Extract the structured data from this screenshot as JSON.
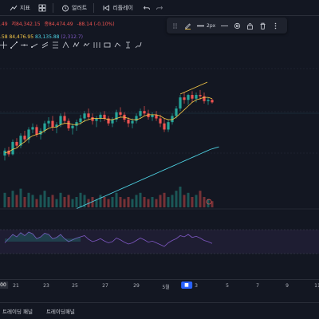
{
  "toolbar": {
    "indicators_label": "지표",
    "alert_label": "얼러트",
    "replay_label": "리플레이"
  },
  "legend": {
    "prefix": ".49",
    "high": "저84,342.15",
    "close": "종84,474.49",
    "change": "-88.14 (-0.10%)",
    "ma_values": [
      ".58",
      "84,476.95",
      "83,135.88",
      "(2,312.7)"
    ]
  },
  "float_toolbar": {
    "stroke_width_label": "2px"
  },
  "xaxis": {
    "ticks": [
      "00",
      "21",
      "23",
      "25",
      "27",
      "29",
      "5월",
      "3",
      "5",
      "7",
      "9",
      "11"
    ],
    "highlight_label": "■"
  },
  "bottom": {
    "tab1": "트레이딩 패널",
    "tab2": "트레이딩패널"
  },
  "colors": {
    "up": "#26a69a",
    "down": "#ef5350",
    "ma_short": "#f7c948",
    "ma_long": "#4dd0e1",
    "rsi": "#7e57c2",
    "accent": "#2962ff"
  },
  "chart_data": {
    "type": "candlestick",
    "candles": [
      [
        80.0,
        80.6,
        79.6,
        80.4
      ],
      [
        80.4,
        80.7,
        79.9,
        80.1
      ],
      [
        80.1,
        81.3,
        80.0,
        81.1
      ],
      [
        81.1,
        81.4,
        80.6,
        80.8
      ],
      [
        80.8,
        81.8,
        80.6,
        81.6
      ],
      [
        81.6,
        82.0,
        81.1,
        81.3
      ],
      [
        81.3,
        82.3,
        81.0,
        82.1
      ],
      [
        82.1,
        82.6,
        81.8,
        82.3
      ],
      [
        82.3,
        82.5,
        81.5,
        81.7
      ],
      [
        81.7,
        82.2,
        81.3,
        82.0
      ],
      [
        82.0,
        82.8,
        81.8,
        82.6
      ],
      [
        82.6,
        83.1,
        82.3,
        82.8
      ],
      [
        82.8,
        83.2,
        82.0,
        82.3
      ],
      [
        82.3,
        82.7,
        81.8,
        82.5
      ],
      [
        82.5,
        83.4,
        82.3,
        83.2
      ],
      [
        83.2,
        83.5,
        82.6,
        82.8
      ],
      [
        82.8,
        83.0,
        82.0,
        82.2
      ],
      [
        82.2,
        82.6,
        81.7,
        82.4
      ],
      [
        82.4,
        82.9,
        82.0,
        82.7
      ],
      [
        82.7,
        83.3,
        82.5,
        83.0
      ],
      [
        83.0,
        83.6,
        82.7,
        83.4
      ],
      [
        83.4,
        83.8,
        82.9,
        83.1
      ],
      [
        83.1,
        83.4,
        82.5,
        82.8
      ],
      [
        82.8,
        83.2,
        82.3,
        83.0
      ],
      [
        83.0,
        83.5,
        82.7,
        83.3
      ],
      [
        83.3,
        83.6,
        82.8,
        83.0
      ],
      [
        83.0,
        83.2,
        82.4,
        82.6
      ],
      [
        82.6,
        83.1,
        82.3,
        82.9
      ],
      [
        82.9,
        83.7,
        82.7,
        83.5
      ],
      [
        83.5,
        83.9,
        83.1,
        83.3
      ],
      [
        83.3,
        83.5,
        82.7,
        82.9
      ],
      [
        82.9,
        83.1,
        82.3,
        82.6
      ],
      [
        82.6,
        83.0,
        82.2,
        82.8
      ],
      [
        82.8,
        83.4,
        82.6,
        83.2
      ],
      [
        83.2,
        83.8,
        83.0,
        83.6
      ],
      [
        83.6,
        84.0,
        83.2,
        83.4
      ],
      [
        83.4,
        83.7,
        82.9,
        83.1
      ],
      [
        83.1,
        83.5,
        82.8,
        83.3
      ],
      [
        83.3,
        83.6,
        82.8,
        83.0
      ],
      [
        83.0,
        83.3,
        82.3,
        82.6
      ],
      [
        82.6,
        83.0,
        81.9,
        82.1
      ],
      [
        82.1,
        82.9,
        81.9,
        82.7
      ],
      [
        82.7,
        83.4,
        82.5,
        83.2
      ],
      [
        83.2,
        84.0,
        83.0,
        83.8
      ],
      [
        83.8,
        84.9,
        83.6,
        84.7
      ],
      [
        84.7,
        85.1,
        84.2,
        84.5
      ],
      [
        84.5,
        85.0,
        84.1,
        84.9
      ],
      [
        84.9,
        85.2,
        84.3,
        84.6
      ],
      [
        84.6,
        85.1,
        84.3,
        84.9
      ],
      [
        84.9,
        85.3,
        84.5,
        84.8
      ],
      [
        84.8,
        85.1,
        84.2,
        84.4
      ],
      [
        84.4,
        84.7,
        84.1,
        84.5
      ],
      [
        84.5,
        84.6,
        84.2,
        84.3
      ]
    ],
    "volumes": [
      7,
      5,
      8,
      6,
      9,
      5,
      7,
      6,
      4,
      6,
      8,
      5,
      6,
      4,
      7,
      5,
      6,
      4,
      5,
      7,
      6,
      4,
      5,
      4,
      6,
      5,
      4,
      5,
      7,
      5,
      4,
      5,
      4,
      6,
      7,
      5,
      4,
      5,
      4,
      6,
      7,
      5,
      6,
      8,
      10,
      6,
      7,
      5,
      6,
      8,
      5,
      4,
      3
    ],
    "ma_short": [
      80.2,
      80.3,
      80.5,
      80.6,
      80.9,
      81.1,
      81.4,
      81.6,
      81.7,
      81.8,
      82.0,
      82.2,
      82.3,
      82.3,
      82.5,
      82.6,
      82.6,
      82.5,
      82.5,
      82.6,
      82.8,
      82.9,
      83.0,
      83.0,
      83.0,
      83.0,
      82.9,
      82.9,
      83.0,
      83.1,
      83.1,
      83.0,
      82.9,
      82.9,
      83.0,
      83.2,
      83.3,
      83.3,
      83.3,
      83.2,
      83.0,
      82.9,
      82.9,
      83.1,
      83.4,
      83.7,
      84.0,
      84.3,
      84.5,
      84.6,
      84.7,
      84.7,
      84.6
    ],
    "ma_long": [
      78.2,
      78.35,
      78.5,
      78.65,
      78.8,
      78.95,
      79.1,
      79.25,
      79.4,
      79.55,
      79.7,
      79.85,
      80.0,
      80.15,
      80.3,
      80.45,
      80.6,
      80.75,
      80.9,
      81.05,
      81.2,
      81.35,
      81.5,
      81.65,
      81.8,
      81.95,
      82.1,
      82.25,
      82.4,
      82.55,
      82.7,
      82.85,
      83.0,
      83.1,
      83.2
    ],
    "rsi": [
      48,
      55,
      62,
      58,
      65,
      60,
      66,
      63,
      55,
      58,
      64,
      62,
      55,
      57,
      62,
      55,
      50,
      53,
      56,
      58,
      60,
      54,
      50,
      52,
      55,
      51,
      48,
      50,
      56,
      53,
      49,
      46,
      48,
      52,
      56,
      53,
      49,
      51,
      48,
      45,
      42,
      48,
      52,
      55,
      60,
      58,
      62,
      57,
      59,
      56,
      52,
      50,
      47
    ],
    "xlabels": [
      "00",
      "21",
      "23",
      "25",
      "27",
      "29",
      "5월",
      "3",
      "5",
      "7",
      "9",
      "11"
    ]
  }
}
